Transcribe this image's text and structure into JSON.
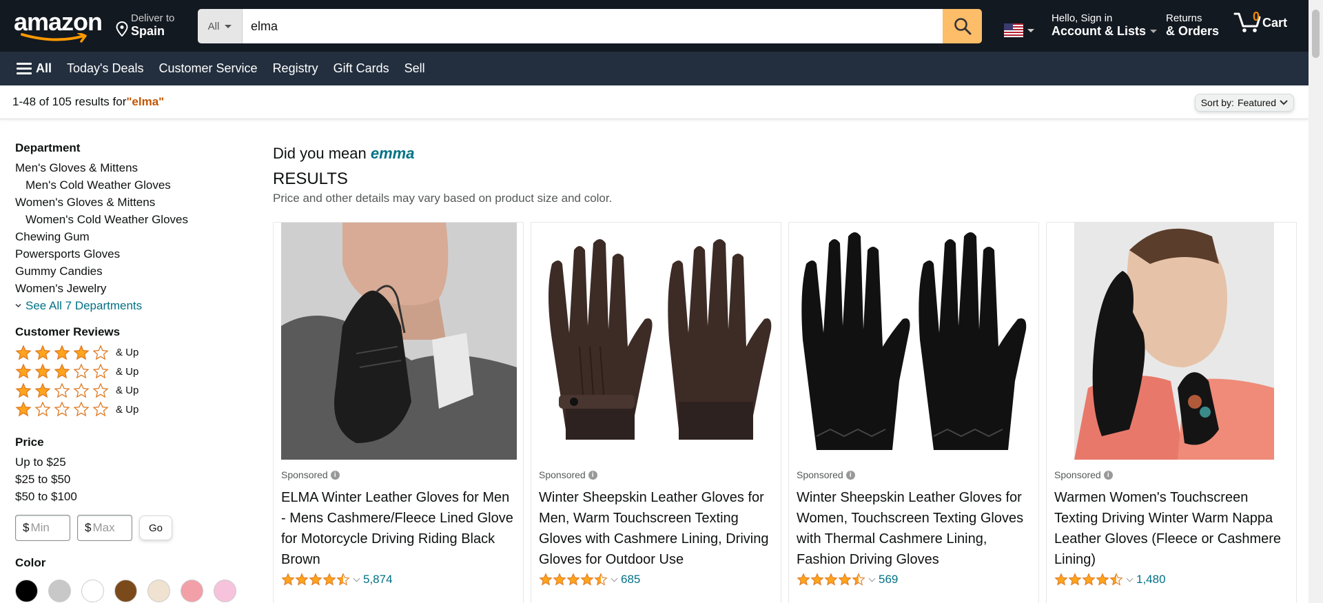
{
  "header": {
    "logo": "amazon",
    "deliver_line1": "Deliver to",
    "deliver_line2": "Spain",
    "search_category": "All",
    "search_value": "elma",
    "account_line1": "Hello, Sign in",
    "account_line2": "Account & Lists",
    "orders_line1": "Returns",
    "orders_line2": "& Orders",
    "cart_count": "0",
    "cart_label": "Cart"
  },
  "subnav": {
    "all": "All",
    "items": [
      "Today's Deals",
      "Customer Service",
      "Registry",
      "Gift Cards",
      "Sell"
    ]
  },
  "results_bar": {
    "summary": "1-48 of 105 results for ",
    "query": "\"elma\"",
    "sort_label": "Sort by:",
    "sort_value": "Featured"
  },
  "sidebar": {
    "department_heading": "Department",
    "departments": [
      {
        "label": "Men's Gloves & Mittens",
        "indent": false
      },
      {
        "label": "Men's Cold Weather Gloves",
        "indent": true
      },
      {
        "label": "Women's Gloves & Mittens",
        "indent": false
      },
      {
        "label": "Women's Cold Weather Gloves",
        "indent": true
      },
      {
        "label": "Chewing Gum",
        "indent": false
      },
      {
        "label": "Powersports Gloves",
        "indent": false
      },
      {
        "label": "Gummy Candies",
        "indent": false
      },
      {
        "label": "Women's Jewelry",
        "indent": false
      }
    ],
    "see_all": "See All 7 Departments",
    "reviews_heading": "Customer Reviews",
    "reviews": [
      {
        "stars": 4,
        "label": "& Up"
      },
      {
        "stars": 3,
        "label": "& Up"
      },
      {
        "stars": 2,
        "label": "& Up"
      },
      {
        "stars": 1,
        "label": "& Up"
      }
    ],
    "price_heading": "Price",
    "prices": [
      "Up to $25",
      "$25 to $50",
      "$50 to $100"
    ],
    "min_currency": "$",
    "min_placeholder": "Min",
    "max_currency": "$",
    "max_placeholder": "Max",
    "go_label": "Go",
    "color_heading": "Color",
    "colors": [
      "#000000",
      "#c8c8c8",
      "#ffffff",
      "#7b4a1a",
      "#efe2d0",
      "#f29fa8",
      "#f6c2dc"
    ]
  },
  "main": {
    "did_you_mean": "Did you mean ",
    "suggestion": "emma",
    "results_heading": "RESULTS",
    "results_sub": "Price and other details may vary based on product size and color."
  },
  "products": [
    {
      "sponsored": "Sponsored",
      "title": "ELMA Winter Leather Gloves for Men - Mens Cashmere/Fleece Lined Glove for Motorcycle Driving Riding Black Brown",
      "rating": 4.5,
      "reviews": "5,874"
    },
    {
      "sponsored": "Sponsored",
      "title": "Winter Sheepskin Leather Gloves for Men, Warm Touchscreen Texting Gloves with Cashmere Lining, Driving Gloves for Outdoor Use",
      "rating": 4.5,
      "reviews": "685"
    },
    {
      "sponsored": "Sponsored",
      "title": "Winter Sheepskin Leather Gloves for Women, Touchscreen Texting Gloves with Thermal Cashmere Lining, Fashion Driving Gloves",
      "rating": 4.5,
      "reviews": "569"
    },
    {
      "sponsored": "Sponsored",
      "title": "Warmen Women's Touchscreen Texting Driving Winter Warm Nappa Leather Gloves (Fleece or Cashmere Lining)",
      "rating": 4.5,
      "reviews": "1,480"
    }
  ],
  "colors": {
    "nav_bg": "#131921",
    "subnav_bg": "#232f3e",
    "search_button": "#febd69",
    "star": "#ffa41c",
    "link": "#007185",
    "query": "#c45500"
  }
}
